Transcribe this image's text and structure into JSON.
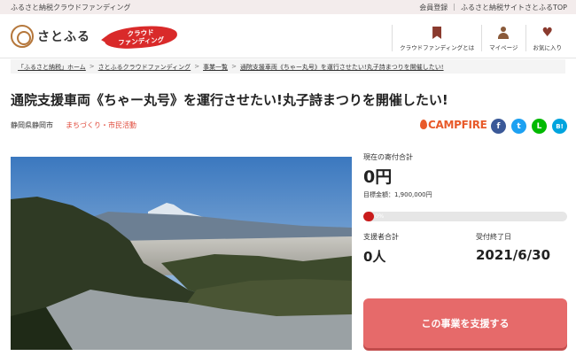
{
  "topbar": {
    "tagline": "ふるさと納税クラウドファンディング",
    "links": [
      "会員登録",
      "ふるさと納税サイトさとふるTOP"
    ]
  },
  "header": {
    "logo_text": "さとふる",
    "badge_line1": "クラウド",
    "badge_line2": "ファンディング",
    "nav": [
      {
        "label": "クラウドファンディングとは",
        "icon": "bookmark-icon"
      },
      {
        "label": "マイページ",
        "icon": "user-icon"
      },
      {
        "label": "お気に入り",
        "icon": "heart-icon"
      }
    ]
  },
  "breadcrumb": [
    "「ふるさと納税」ホーム",
    "さとふるクラウドファンディング",
    "事業一覧",
    "通院支援車両《ちゃー丸号》を運行させたい!丸子詩まつりを開催したい!"
  ],
  "project": {
    "title": "通院支援車両《ちゃー丸号》を運行させたい!丸子詩まつりを開催したい!",
    "location": "静岡県静岡市",
    "category": "まちづくり・市民活動",
    "partner": "CAMPFIRE",
    "share": [
      "f",
      "t",
      "L",
      "B!"
    ]
  },
  "funding": {
    "current_label": "現在の寄付合計",
    "current_amount": "0円",
    "goal_text": "目標金額：1,900,000円",
    "progress_percent": 0,
    "progress_label": "0%",
    "supporters_label": "支援者合計",
    "supporters_value": "0人",
    "end_label": "受付終了日",
    "end_value": "2021/6/30",
    "support_button": "この事業を支援する"
  },
  "colors": {
    "accent_red": "#d92a2a",
    "button": "#e66a6a",
    "category": "#e0493a",
    "campfire": "#e85a2a"
  }
}
